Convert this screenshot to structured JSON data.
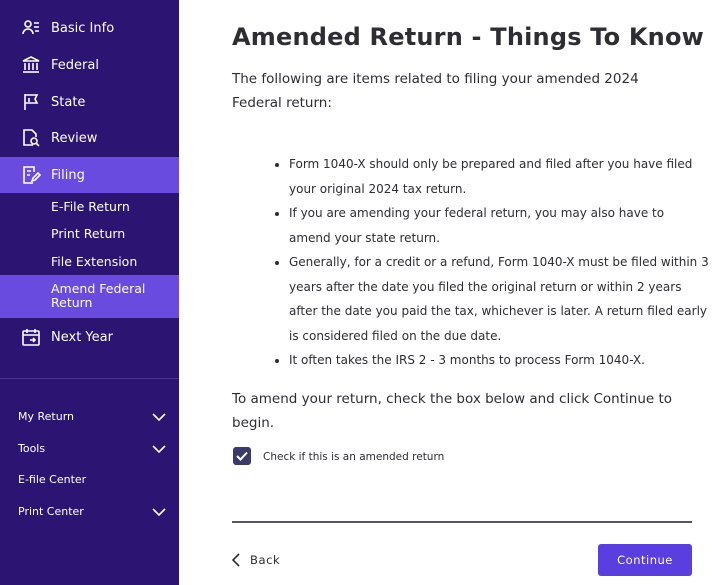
{
  "colors": {
    "sidebar_bg": "#2c1572",
    "sidebar_active": "#6a4be0",
    "primary_button": "#5a3ee0",
    "text": "#2d2d33"
  },
  "sidebar": {
    "items": [
      {
        "label": "Basic Info",
        "icon": "person-list-icon"
      },
      {
        "label": "Federal",
        "icon": "building-icon"
      },
      {
        "label": "State",
        "icon": "flag-icon"
      },
      {
        "label": "Review",
        "icon": "document-search-icon"
      },
      {
        "label": "Filing",
        "icon": "document-edit-icon",
        "active": true
      },
      {
        "label": "Next Year",
        "icon": "calendar-icon"
      }
    ],
    "filing_subitems": [
      {
        "label": "E-File Return"
      },
      {
        "label": "Print Return"
      },
      {
        "label": "File Extension"
      },
      {
        "label": "Amend Federal Return",
        "active": true
      }
    ],
    "bottom_items": [
      {
        "label": "My Return",
        "expandable": true
      },
      {
        "label": "Tools",
        "expandable": true
      },
      {
        "label": "E-file Center",
        "expandable": false
      },
      {
        "label": "Print Center",
        "expandable": true
      }
    ]
  },
  "main": {
    "title": "Amended Return - Things To Know",
    "intro": "The following are items related to filing your amended 2024 Federal return:",
    "bullets": [
      "Form 1040-X should only be prepared and filed after you have filed your original 2024 tax return.",
      "If you are amending your federal return, you may also have to amend your state return.",
      "Generally, for a credit or a refund, Form 1040-X must be filed within 3 years after the date you filed the original return or within 2 years after the date you paid the tax, whichever is later. A return filed early is considered filed on the due date.",
      "It often takes the IRS 2 - 3 months to process Form 1040-X."
    ],
    "amend_instructions": "To amend your return, check the box below and click Continue to begin.",
    "checkbox_label": "Check if this is an amended return",
    "checkbox_checked": true,
    "back_label": "Back",
    "continue_label": "Continue"
  }
}
